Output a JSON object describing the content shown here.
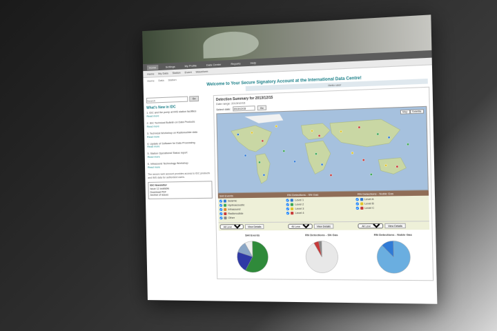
{
  "topnav": [
    "",
    "",
    "",
    "",
    "",
    ""
  ],
  "menubar": [
    "Home",
    "Settings",
    "My Profile",
    "Data Center",
    "Reports",
    "Help"
  ],
  "subbar": [
    "Home",
    "My Data",
    "Station",
    "Event",
    "Waveform"
  ],
  "crumb": [
    "Home",
    "Data",
    "Station"
  ],
  "welcome": "Welcome to Your Secure Signatory Account at the International Data Centre!",
  "hello": "Hello user",
  "left": {
    "search_placeholder": "Search",
    "search_button": "Go",
    "news_title": "What's New in IDC",
    "news": [
      {
        "text": "IDC and the pump at IMS station facilities",
        "link": "Read more"
      },
      {
        "text": "IDC Technical Bulletin on Data Products",
        "link": "Read more"
      },
      {
        "text": "Technical Workshop on Radionuclide data",
        "link": "Read more"
      },
      {
        "text": "Update of Software for Data Processing",
        "link": "Read more"
      },
      {
        "text": "Station Operational Status report",
        "link": "Read more"
      },
      {
        "text": "Infrasound Technology Workshop",
        "link": "Read more"
      }
    ],
    "para": "The secure web account provides access to IDC products and IMS data for authorized users.",
    "box_title": "IDC Newsletter",
    "box_lines": [
      "Issue 12 available",
      "Download PDF",
      "Archive of issues"
    ]
  },
  "right": {
    "title": "Detection Summary for 2013/12/15",
    "subtitle": "Date range: 2013/12/15",
    "date_label": "Select date:",
    "date_value": "2013/12/15",
    "date_button": "Go",
    "map_toggle": [
      "Map",
      "Satellite"
    ],
    "legend_headers": [
      "SHI Events",
      "RN Detections - SN Gas",
      "RN Detections - Noble Gas"
    ],
    "legend_cols": [
      [
        "Seismic",
        "Hydroacoustic",
        "Infrasound",
        "Radionuclide",
        "Other"
      ],
      [
        "Level 1",
        "Level 2",
        "Level 3",
        "Level 4"
      ],
      [
        "Level A",
        "Level B",
        "Level C"
      ]
    ],
    "legend_colors": [
      [
        "#2f7ad6",
        "#3aa655",
        "#e08a2c",
        "#c63a3a",
        "#888888"
      ],
      [
        "#2f7ad6",
        "#3aa655",
        "#e0c52c",
        "#c63a3a"
      ],
      [
        "#2f7ad6",
        "#e0c52c",
        "#c63a3a"
      ]
    ],
    "select_values": [
      "All Levels",
      "All Levels",
      "All Levels"
    ],
    "view_buttons": [
      "View Details",
      "View Details",
      "View Details"
    ]
  },
  "chart_data": [
    {
      "type": "pie",
      "title": "SHI Events",
      "categories": [
        "Seismic",
        "Hydroacoustic",
        "Infrasound",
        "Other"
      ],
      "values": [
        58,
        22,
        12,
        8
      ],
      "colors": [
        "#2f8a3a",
        "#2f3aa6",
        "#8aa6c6",
        "#f0f0f0"
      ]
    },
    {
      "type": "pie",
      "title": "RN Detections - SN Gas",
      "categories": [
        "Level 1",
        "Level 2",
        "Level 3"
      ],
      "values": [
        92,
        5,
        3
      ],
      "colors": [
        "#e8e8e8",
        "#c63a3a",
        "#888888"
      ]
    },
    {
      "type": "pie",
      "title": "RN Detections - Noble Gas",
      "categories": [
        "Level A",
        "Level B"
      ],
      "values": [
        88,
        12
      ],
      "colors": [
        "#6aaee0",
        "#2f7ad6"
      ]
    }
  ]
}
